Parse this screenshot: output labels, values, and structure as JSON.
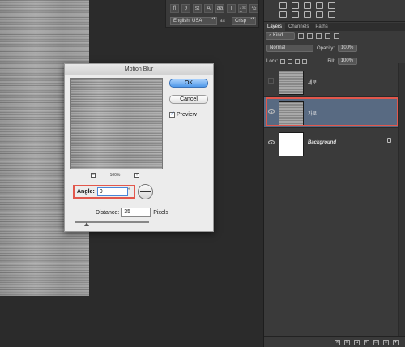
{
  "character_panel": {
    "language": "English: USA",
    "antialias": "Crisp",
    "fraction_glyph": "fi"
  },
  "dialog": {
    "title": "Motion Blur",
    "ok_label": "OK",
    "cancel_label": "Cancel",
    "preview_label": "Preview",
    "preview_checked": true,
    "zoom_level": "100%",
    "angle_label": "Angle:",
    "angle_value": "0",
    "degree_symbol": "°",
    "distance_label": "Distance:",
    "distance_value": "35",
    "distance_unit": "Pixels"
  },
  "layers_panel": {
    "tabs": [
      "Layers",
      "Channels",
      "Paths"
    ],
    "filter_kind": "Kind",
    "blend_mode": "Normal",
    "opacity_label": "Opacity:",
    "opacity_value": "100%",
    "lock_label": "Lock:",
    "fill_label": "Fill:",
    "fill_value": "100%",
    "layers": [
      {
        "name": "세로",
        "visible": false,
        "selected": false
      },
      {
        "name": "가로",
        "visible": true,
        "selected": true
      },
      {
        "name": "Background",
        "visible": true,
        "selected": false,
        "locked": true
      }
    ],
    "bottom_icons": [
      "link-icon",
      "fx-icon",
      "mask-icon",
      "adjustment-icon",
      "group-icon",
      "new-layer-icon",
      "trash-icon"
    ]
  },
  "colors": {
    "highlight_red": "#e2574c",
    "selected_layer": "#586a82",
    "ok_blue": "#4f99ea"
  }
}
